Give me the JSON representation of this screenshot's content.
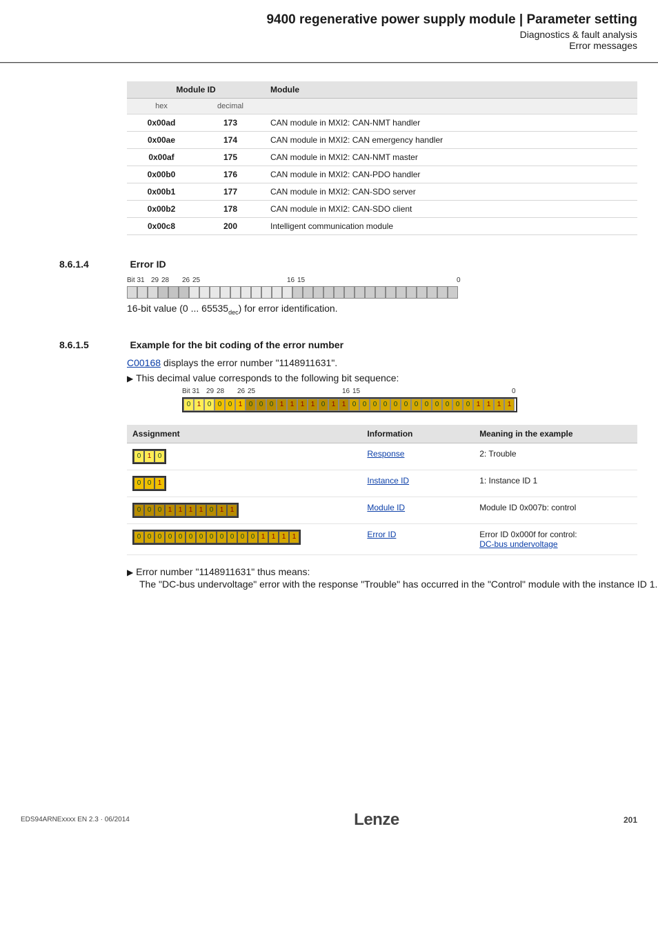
{
  "header": {
    "title": "9400 regenerative power supply module | Parameter setting",
    "sub1": "Diagnostics & fault analysis",
    "sub2": "Error messages"
  },
  "module_table": {
    "hdr_id": "Module ID",
    "hdr_mod": "Module",
    "sub_hex": "hex",
    "sub_dec": "decimal",
    "rows": [
      {
        "hex": "0x00ad",
        "dec": "173",
        "mod": "CAN module in MXI2: CAN-NMT handler"
      },
      {
        "hex": "0x00ae",
        "dec": "174",
        "mod": "CAN module in MXI2: CAN emergency handler"
      },
      {
        "hex": "0x00af",
        "dec": "175",
        "mod": "CAN module in MXI2: CAN-NMT master"
      },
      {
        "hex": "0x00b0",
        "dec": "176",
        "mod": "CAN module in MXI2: CAN-PDO handler"
      },
      {
        "hex": "0x00b1",
        "dec": "177",
        "mod": "CAN module in MXI2: CAN-SDO server"
      },
      {
        "hex": "0x00b2",
        "dec": "178",
        "mod": "CAN module in MXI2: CAN-SDO client"
      },
      {
        "hex": "0x00c8",
        "dec": "200",
        "mod": "Intelligent communication module"
      }
    ]
  },
  "sec814": {
    "num": "8.6.1.4",
    "title": "Error ID"
  },
  "bitlabels": {
    "b31": "Bit 31",
    "b29": "29",
    "b28": "28",
    "b26": "26",
    "b25": "25",
    "b16": "16",
    "b15": "15",
    "b0": "0"
  },
  "errid_text_a": "16-bit value (0 ... 65535",
  "errid_text_sub": "dec",
  "errid_text_b": ") for error identification.",
  "sec815": {
    "num": "8.6.1.5",
    "title": "Example for the bit coding of the error number"
  },
  "ex_link": "C00168",
  "ex_text": " displays the error number \"1148911631\".",
  "ex_bullet": "This decimal value corresponds to the following bit sequence:",
  "example_bits": [
    "0",
    "1",
    "0",
    "0",
    "0",
    "1",
    "0",
    "0",
    "0",
    "1",
    "1",
    "1",
    "1",
    "0",
    "1",
    "1",
    "0",
    "0",
    "0",
    "0",
    "0",
    "0",
    "0",
    "0",
    "0",
    "0",
    "0",
    "0",
    "1",
    "1",
    "1",
    "1"
  ],
  "asg": {
    "h1": "Assignment",
    "h2": "Information",
    "h3": "Meaning in the example",
    "rows": [
      {
        "bits": [
          "0",
          "1",
          "0"
        ],
        "cls": "y0",
        "info": "Response",
        "link": true,
        "mean": "2: Trouble"
      },
      {
        "bits": [
          "0",
          "0",
          "1"
        ],
        "cls": "y1",
        "info": "Instance ID",
        "link": true,
        "mean": "1: Instance ID 1"
      },
      {
        "bits": [
          "0",
          "0",
          "0",
          "1",
          "1",
          "1",
          "1",
          "0",
          "1",
          "1"
        ],
        "cls": "y2",
        "info": "Module ID",
        "link": true,
        "mean": "Module ID 0x007b: control"
      },
      {
        "bits": [
          "0",
          "0",
          "0",
          "0",
          "0",
          "0",
          "0",
          "0",
          "0",
          "0",
          "0",
          "0",
          "1",
          "1",
          "1",
          "1"
        ],
        "cls": "y3",
        "info": "Error ID",
        "link": true,
        "mean": "Error ID 0x000f for control:",
        "mean_link": "DC-bus undervoltage"
      }
    ]
  },
  "concl1": "Error number \"1148911631\" thus means:",
  "concl2": "The \"DC-bus undervoltage\" error with the response \"Trouble\" has occurred in the \"Control\" module with the instance ID 1.",
  "footer": {
    "doc": "EDS94ARNExxxx EN 2.3 · 06/2014",
    "logo": "Lenze",
    "page": "201"
  }
}
